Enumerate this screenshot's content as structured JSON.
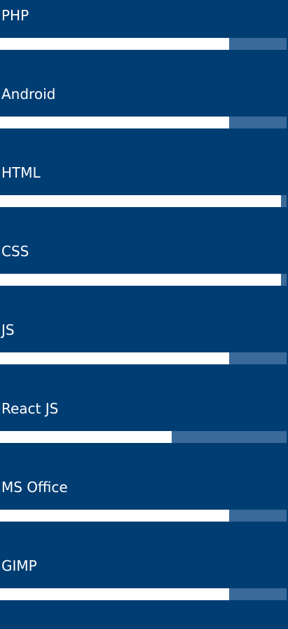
{
  "skills": [
    {
      "label": "PHP",
      "level": 0.8
    },
    {
      "label": "Android",
      "level": 0.8
    },
    {
      "label": "HTML",
      "level": 0.98
    },
    {
      "label": "CSS",
      "level": 0.98
    },
    {
      "label": "JS",
      "level": 0.8
    },
    {
      "label": "React JS",
      "level": 0.6
    },
    {
      "label": "MS Office",
      "level": 0.8
    },
    {
      "label": "GIMP",
      "level": 0.8
    }
  ],
  "colors": {
    "background": "#003d73",
    "bar_track": "#3a6a99",
    "bar_fill": "#ffffff",
    "text": "#ffffff"
  }
}
